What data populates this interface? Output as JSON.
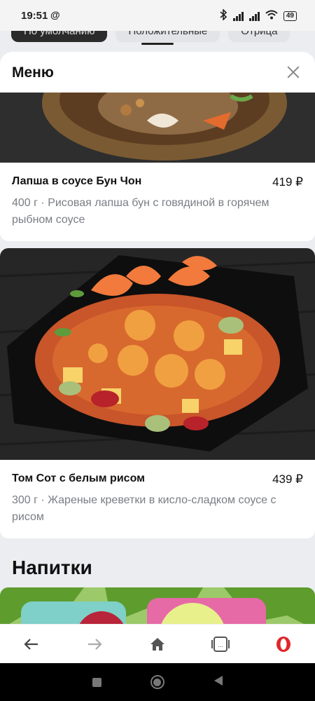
{
  "status": {
    "time": "19:51",
    "battery": "49"
  },
  "filters": [
    "По умолчанию",
    "Положительные",
    "Отрица"
  ],
  "sheet": {
    "title": "Меню"
  },
  "items": [
    {
      "name": "Лапша в соусе Бун Чон",
      "price": "419 ₽",
      "desc": "400 г · Рисовая лапша бун с говядиной в горячем рыбном соусе"
    },
    {
      "name": "Том Сот с белым рисом",
      "price": "439 ₽",
      "desc": "300 г · Жареные креветки в кисло-сладком соусе с рисом"
    }
  ],
  "section": "Напитки",
  "icons": {
    "back": "arrow-left-icon",
    "forward": "arrow-right-icon",
    "home": "home-icon",
    "tabs": "tabs-icon",
    "browser": "opera-logo-icon"
  },
  "colors": {
    "opera_red": "#e0262b",
    "muted_text": "#7a7d84"
  }
}
